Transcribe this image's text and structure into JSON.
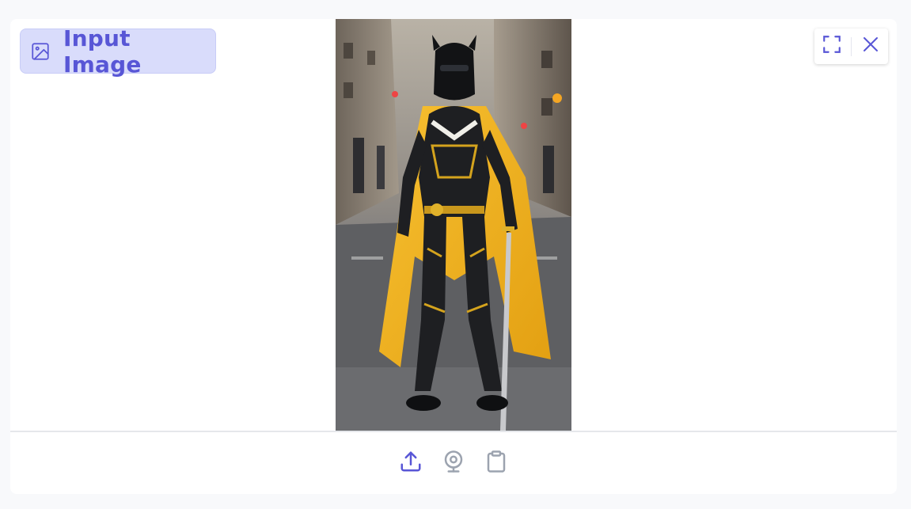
{
  "input_label": "Input Image",
  "icons": {
    "label": "image-icon",
    "fullscreen": "fullscreen-icon",
    "close": "close-icon",
    "upload": "upload-icon",
    "webcam": "webcam-icon",
    "clipboard": "clipboard-icon"
  },
  "colors": {
    "accent": "#5856d6",
    "chip_bg": "#d9dcfb",
    "muted_icon": "#9ca3af",
    "cape": "#f4b323",
    "armor": "#1e1f22"
  },
  "sources": [
    "upload",
    "webcam",
    "clipboard"
  ],
  "active_source": "upload"
}
